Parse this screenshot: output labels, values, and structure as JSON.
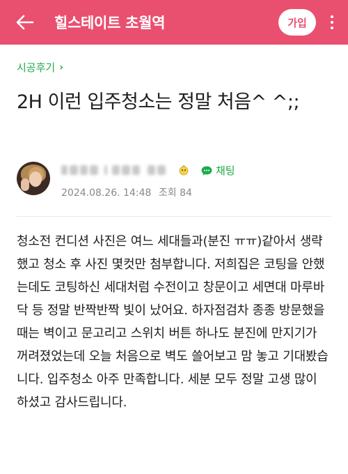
{
  "appbar": {
    "cafe_title": "힐스테이트 초월역",
    "join_label": "가입",
    "back_icon": "arrow-left-icon",
    "more_icon": "more-vertical-icon",
    "color": "#e9506f"
  },
  "board": {
    "label": "시공후기",
    "chevron": "›",
    "color": "#1faa4b"
  },
  "post": {
    "title": "2H 이런 입주청소는 정말 처음^ ^;;",
    "author": {
      "level_icon": "chick-level-icon",
      "chat_label": "채팅",
      "chat_icon": "chat-bubble-icon",
      "date": "2024.08.26. 14:48",
      "views": "조회 84"
    },
    "body": "청소전 컨디션 사진은 여느 세대들과(분진 ㅠㅠ)같아서 생략했고 청소 후 사진 몇컷만 첨부합니다. 저희집은 코팅을 안했는데도 코팅하신 세대처럼 수전이고 창문이고 세면대 마루바닥 등 정말 반짝반짝 빛이 났어요. 하자점검차 종종 방문했을 때는 벽이고 문고리고 스위치 버튼 하나도 분진에 만지기가 꺼려졌었는데 오늘 처음으로 벽도 쓸어보고 맘 놓고 기대봤습니다. 입주청소 아주 만족합니다. 세분 모두 정말 고생 많이 하셨고 감사드립니다."
  }
}
